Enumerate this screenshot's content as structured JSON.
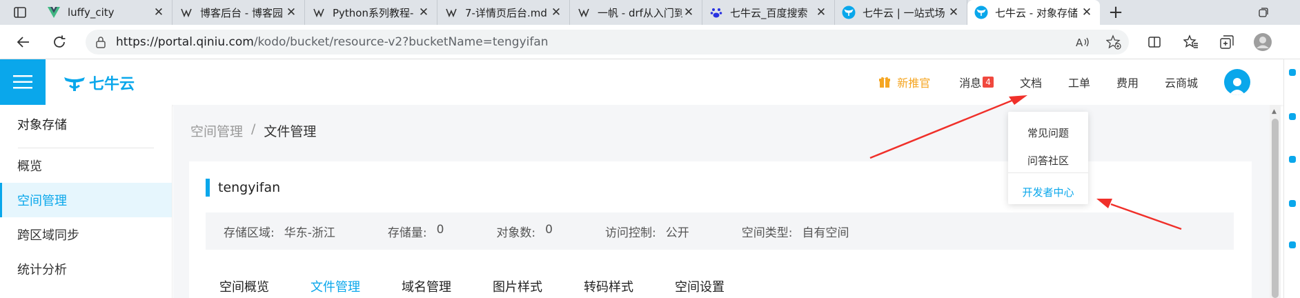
{
  "browser": {
    "tabs": [
      {
        "title": "luffy_city",
        "favicon": "vue-icon"
      },
      {
        "title": "博客后台 - 博客园",
        "favicon": "cnblogs-icon"
      },
      {
        "title": "Python系列教程-",
        "favicon": "cnblogs-icon"
      },
      {
        "title": "7-详情页后台.md",
        "favicon": "cnblogs-icon"
      },
      {
        "title": "一帆 - drf从入门到",
        "favicon": "cnblogs-icon"
      },
      {
        "title": "七牛云_百度搜索",
        "favicon": "baidu-paw-icon"
      },
      {
        "title": "七牛云 | 一站式场",
        "favicon": "qiniu-icon"
      },
      {
        "title": "七牛云 - 对象存储",
        "favicon": "qiniu-icon",
        "active": true
      }
    ],
    "address": {
      "scheme_host": "https://portal.qiniu.com",
      "path": "/kodo/bucket/resource-v2?bucketName=tengyifan"
    }
  },
  "header": {
    "logo_text": "七牛云",
    "nav": {
      "promo": "新推官",
      "messages": "消息",
      "messages_count": "4",
      "docs": "文档",
      "tickets": "工单",
      "billing": "费用",
      "mall": "云商城"
    }
  },
  "sidebar": {
    "title": "对象存储",
    "items": [
      {
        "label": "概览"
      },
      {
        "label": "空间管理",
        "active": true
      },
      {
        "label": "跨区域同步"
      },
      {
        "label": "统计分析"
      }
    ]
  },
  "breadcrumb": {
    "parent": "空间管理",
    "separator": "/",
    "current": "文件管理"
  },
  "bucket": {
    "name": "tengyifan",
    "info": [
      {
        "label": "存储区域:",
        "value": "华东-浙江"
      },
      {
        "label": "存储量:",
        "value": "0"
      },
      {
        "label": "对象数:",
        "value": "0"
      },
      {
        "label": "访问控制:",
        "value": "公开"
      },
      {
        "label": "空间类型:",
        "value": "自有空间"
      }
    ],
    "tabs": [
      {
        "label": "空间概览"
      },
      {
        "label": "文件管理",
        "active": true
      },
      {
        "label": "域名管理"
      },
      {
        "label": "图片样式"
      },
      {
        "label": "转码样式"
      },
      {
        "label": "空间设置"
      }
    ]
  },
  "docs_menu": {
    "items": [
      "常见问题",
      "问答社区",
      "开发者中心"
    ]
  },
  "colors": {
    "brand": "#0aa7eb",
    "promo": "#f5a623",
    "badge": "#f0483e",
    "annotation_arrow": "#f0302a"
  }
}
